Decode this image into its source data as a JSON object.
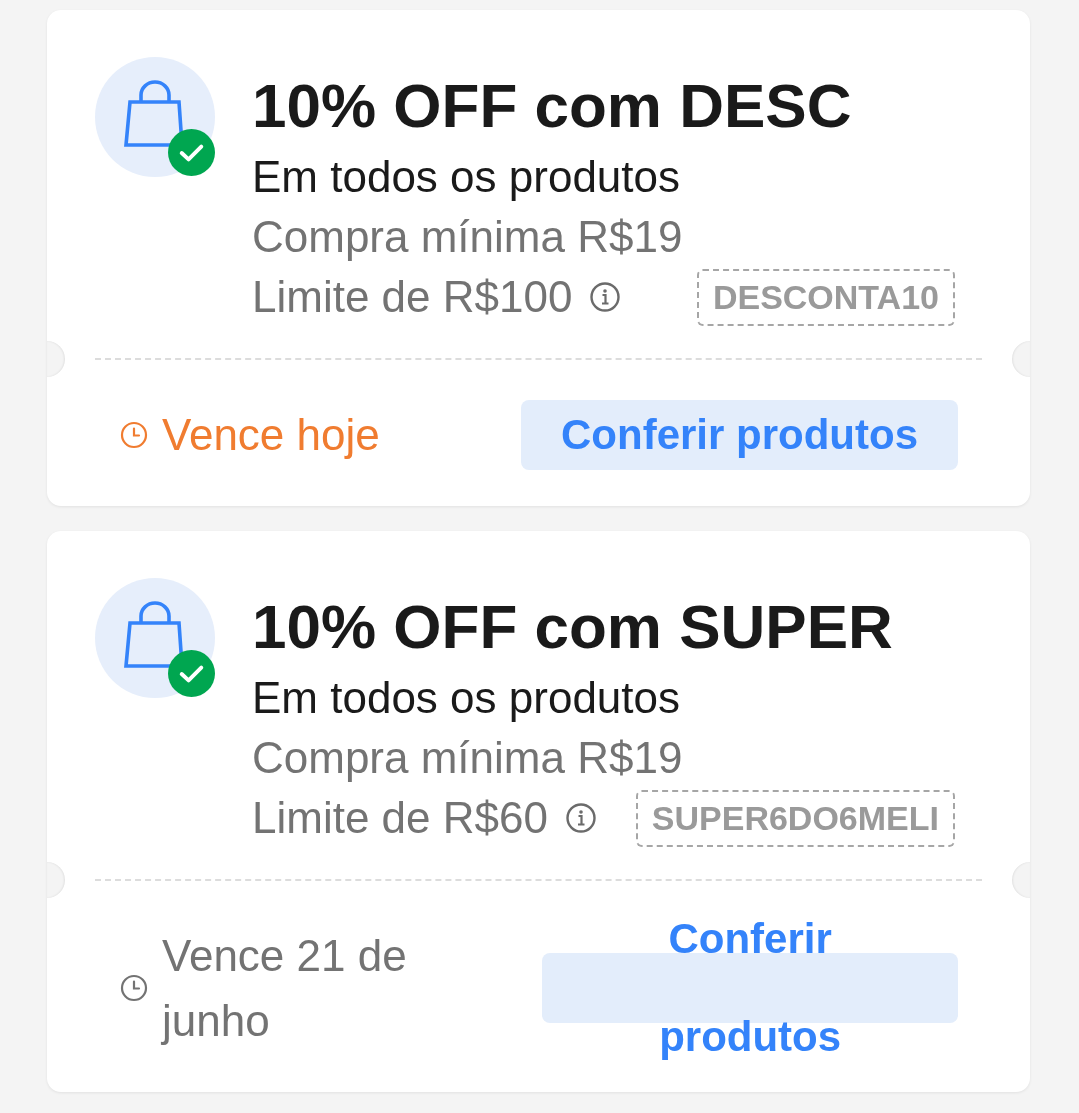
{
  "coupons": [
    {
      "title": "10% OFF com DESC",
      "scope": "Em todos os produtos",
      "minimum_purchase": "Compra mínima R$19",
      "limit": "Limite de R$100",
      "code": "DESCONTA10",
      "expiry": {
        "text": "Vence hoje",
        "urgent": true
      },
      "action": "Conferir produtos"
    },
    {
      "title": "10% OFF com SUPER",
      "scope": "Em todos os produtos",
      "minimum_purchase": "Compra mínima R$19",
      "limit": "Limite de R$60",
      "code": "SUPER6DO6MELI",
      "expiry": {
        "text": "Vence 21 de junho",
        "urgent": false
      },
      "action": "Conferir produtos"
    }
  ]
}
